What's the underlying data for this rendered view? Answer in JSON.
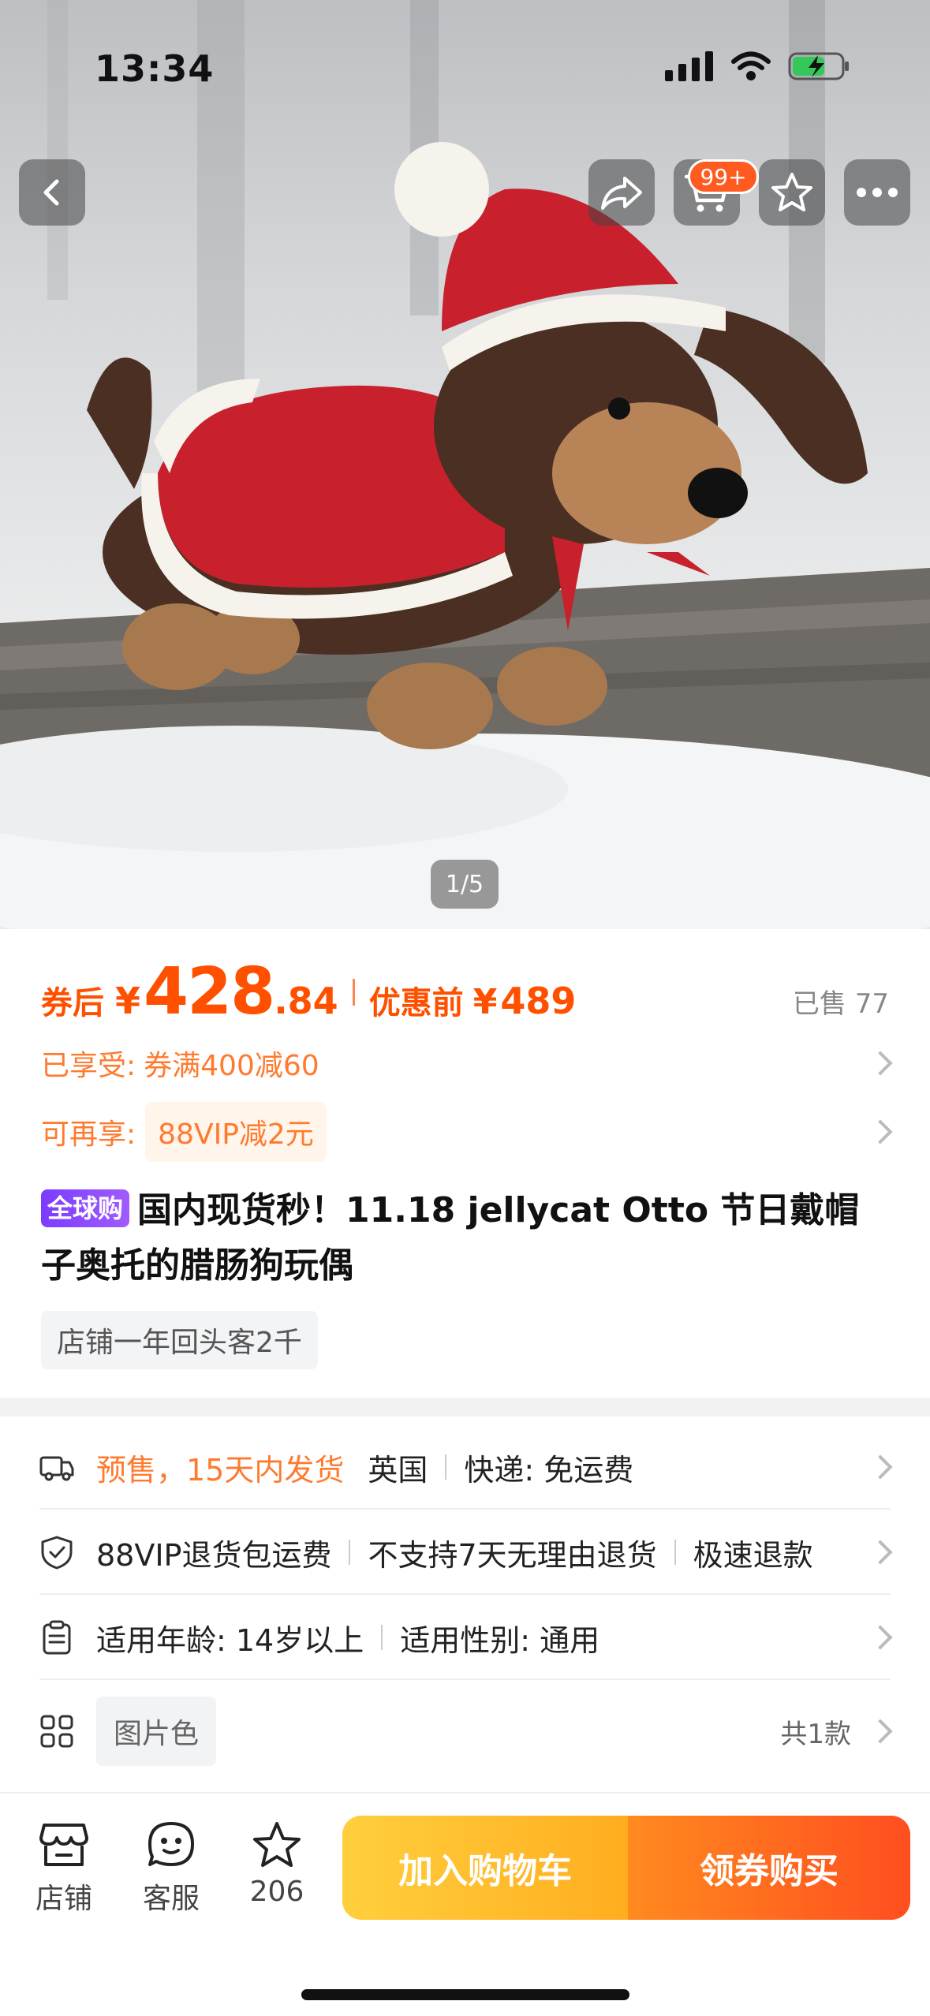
{
  "status_bar": {
    "time": "13:34"
  },
  "hero": {
    "pager": "1/5",
    "cart_badge": "99+"
  },
  "price": {
    "after_coupon_label": "券后",
    "currency": "¥",
    "integer": "428",
    "decimal": ".84",
    "before_label": "优惠前",
    "before_currency": "¥",
    "before_value": "489",
    "sold": "已售 77"
  },
  "promos": {
    "enjoyed_label": "已享受:",
    "enjoyed_value": "券满400减60",
    "more_label": "可再享:",
    "more_value": "88VIP减2元"
  },
  "product": {
    "tag": "全球购",
    "title": "国内现货秒！11.18 jellycat Otto 节日戴帽子奥托的腊肠狗玩偶",
    "shop_tag": "店铺一年回头客2千"
  },
  "shipping": {
    "presale": "预售，15天内发货",
    "origin": "英国",
    "express": "快递: 免运费"
  },
  "service": {
    "item1": "88VIP退货包运费",
    "item2": "不支持7天无理由退货",
    "item3": "极速退款"
  },
  "params": {
    "age": "适用年龄: 14岁以上",
    "gender": "适用性别: 通用"
  },
  "sku": {
    "color": "图片色",
    "count": "共1款"
  },
  "bottom_bar": {
    "shop": "店铺",
    "service": "客服",
    "favorites": "206",
    "add_to_cart": "加入购物车",
    "buy": "领券购买"
  },
  "colors": {
    "accent": "#ff5000",
    "orange": "#ff7a2e",
    "vip_purple": "#7b3cff"
  }
}
